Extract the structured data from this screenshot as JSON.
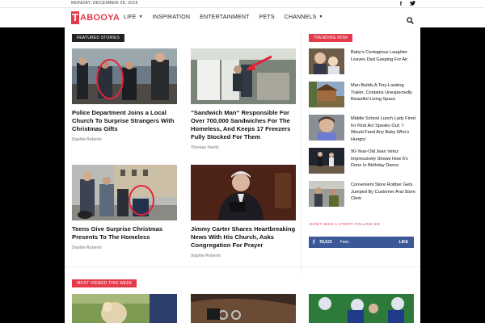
{
  "topbar": {
    "date": "MONDAY, DECEMBER 28, 2015",
    "social_icons": [
      "facebook-icon",
      "twitter-icon"
    ]
  },
  "header": {
    "logo_first": "T",
    "logo_rest": "ABOOYA",
    "nav": [
      {
        "label": "LIFE",
        "dropdown": true
      },
      {
        "label": "INSPIRATION",
        "dropdown": false
      },
      {
        "label": "ENTERTAINMENT",
        "dropdown": false
      },
      {
        "label": "PETS",
        "dropdown": false
      },
      {
        "label": "CHANNELS",
        "dropdown": true
      }
    ],
    "search_icon": "search-icon"
  },
  "featured": {
    "title": "FEATURED STORIES",
    "stories": [
      {
        "title": "Police Department Joins a Local Church To Surprise Strangers With Christmas Gifts",
        "author": "Sophie Roberts"
      },
      {
        "title": "“Sandwich Man” Responsible For Over 700,000 Sandwiches For The Homeless, And Keeps 17 Freezers Fully Stocked For Them",
        "author": "Thomas Hardy"
      },
      {
        "title": "Teens Give Surprise Christmas Presents To The Homeless",
        "author": "Sophie Roberts"
      },
      {
        "title": "Jimmy Carter Shares Heartbreaking News With His Church, Asks Congregation For Prayer",
        "author": "Sophie Roberts"
      }
    ]
  },
  "trending": {
    "title": "TRENDING NOW",
    "items": [
      {
        "title": "Baby's Contagious Laughter Leaves Dad Gasping For Air"
      },
      {
        "title": "Man Builds A Tiny-Looking Trailer, Contains Unexpectedly Beautiful Living Space"
      },
      {
        "title": "Middle School Lunch Lady Fired for Kind Act Speaks Out: 'I Would Feed Any Baby Who's Hungry'"
      },
      {
        "title": "90-Year-Old Jean Veloz Impressively Shows How It's Done In Birthday Dance"
      },
      {
        "title": "Convenient Store Robber Gets Jumped By Customer And Store Clerk"
      }
    ]
  },
  "follow": {
    "label": "DON'T MISS A STORY! FOLLOW US!",
    "fb_glyph": "f",
    "fb_count": "59,623",
    "fb_fans": "Fans",
    "fb_like": "LIKE"
  },
  "most_viewed": {
    "title": "MOST VIEWED THIS WEEK"
  },
  "colors": {
    "accent": "#e43a4c",
    "facebook": "#3b5998",
    "background": "#000000"
  }
}
